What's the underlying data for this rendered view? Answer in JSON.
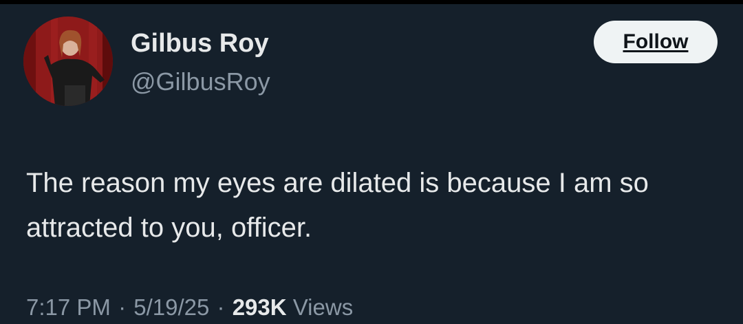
{
  "author": {
    "display_name": "Gilbus Roy",
    "handle": "@GilbusRoy",
    "avatar_icon": "profile-photo"
  },
  "follow_button": {
    "label": "Follow"
  },
  "tweet": {
    "text": "The reason my eyes are dilated is because I am so attracted to you, officer."
  },
  "meta": {
    "time": "7:17 PM",
    "separator": "·",
    "date": "5/19/25",
    "views_count": "293K",
    "views_label": "Views"
  },
  "colors": {
    "background": "#15202b",
    "primary_text": "#e7e9ea",
    "secondary_text": "#8b98a5",
    "follow_button_bg": "#eff3f4"
  }
}
